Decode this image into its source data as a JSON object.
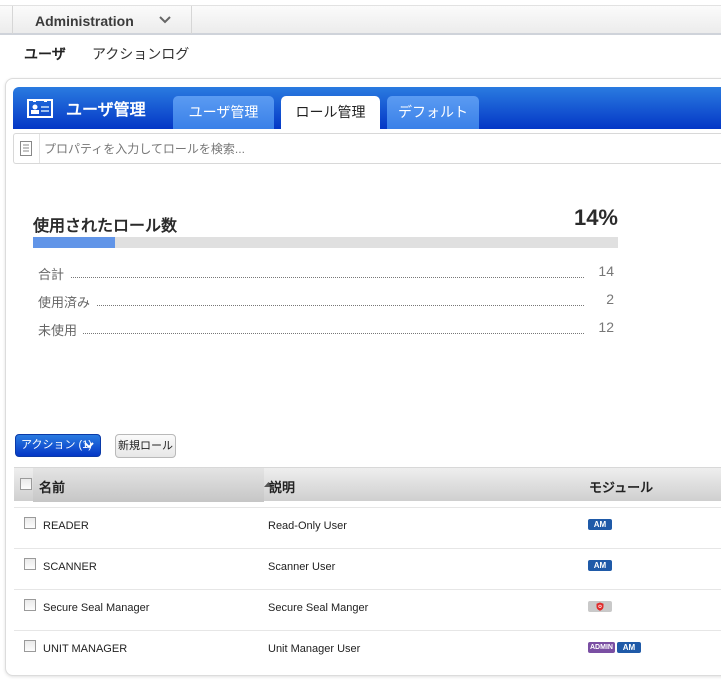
{
  "topbar": {
    "menu_label": "Administration"
  },
  "subnav": {
    "items": [
      {
        "label": "ユーザ",
        "active": true
      },
      {
        "label": "アクションログ",
        "active": false
      }
    ]
  },
  "panel": {
    "title": "ユーザ管理",
    "tabs": [
      {
        "label": "ユーザ管理"
      },
      {
        "label": "ロール管理",
        "active": true
      },
      {
        "label": "デフォルト"
      }
    ],
    "search": {
      "placeholder": "プロパティを入力してロールを検索...",
      "value": ""
    }
  },
  "stats": {
    "title": "使用されたロール数",
    "percent_label": "14%",
    "percent": 14,
    "rows": [
      {
        "label": "合計",
        "value": "14"
      },
      {
        "label": "使用済み",
        "value": "2"
      },
      {
        "label": "未使用",
        "value": "12"
      }
    ]
  },
  "toolbar": {
    "action_label": "アクション (1)",
    "new_role_label": "新規ロール"
  },
  "table": {
    "columns": {
      "name": "名前",
      "description": "説明",
      "module": "モジュール"
    },
    "rows": [
      {
        "name": "READER",
        "description": "Read-Only User",
        "modules": [
          "AM"
        ]
      },
      {
        "name": "SCANNER",
        "description": "Scanner User",
        "modules": [
          "AM"
        ]
      },
      {
        "name": "Secure Seal Manager",
        "description": "Secure Seal Manger",
        "modules": [
          "secure-seal-icon"
        ]
      },
      {
        "name": "UNIT MANAGER",
        "description": "Unit Manager User",
        "modules": [
          "ADMIN",
          "AM"
        ]
      }
    ]
  },
  "colors": {
    "accent_blue": "#0437c6",
    "progress_fill": "#6195e8",
    "badge_am": "#1f5aa8",
    "badge_admin": "#7a4fa3"
  }
}
